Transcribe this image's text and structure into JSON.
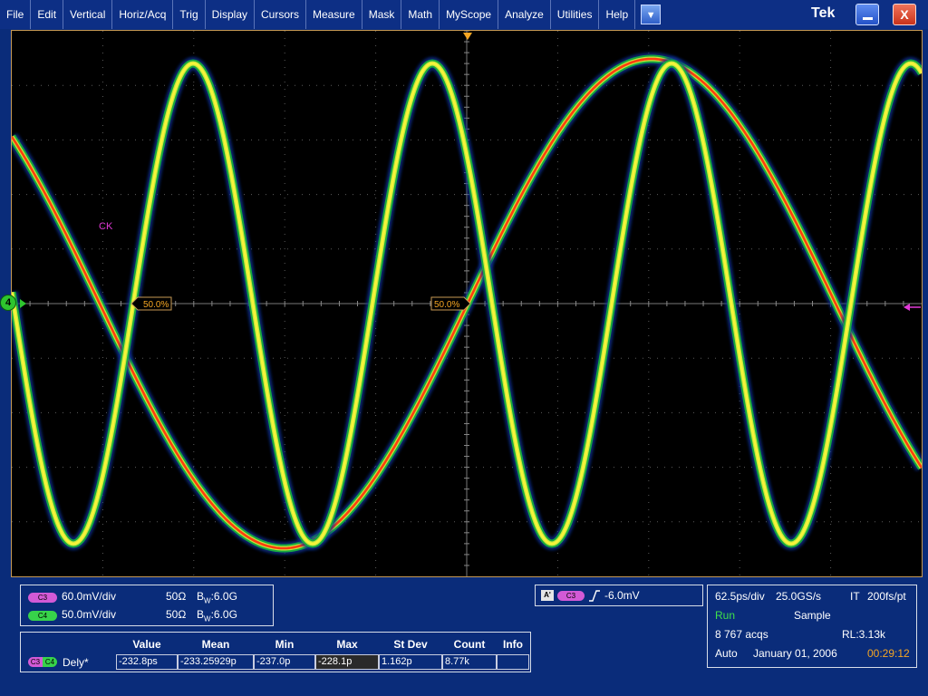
{
  "menu": [
    "File",
    "Edit",
    "Vertical",
    "Horiz/Acq",
    "Trig",
    "Display",
    "Cursors",
    "Measure",
    "Mask",
    "Math",
    "MyScope",
    "Analyze",
    "Utilities",
    "Help"
  ],
  "window": {
    "logo": "Tek",
    "minimize_label": "_",
    "close_label": "X"
  },
  "screen": {
    "channel_label": "CK",
    "ref_marker": "4",
    "level_labels": [
      "50.0%",
      "50.0%"
    ],
    "colors": {
      "grid": "#5b5b5b",
      "trace_c3": "#ff3d10",
      "trace_c4": "#f7f43a",
      "glow": "#18b63a",
      "trigger": "#f5a623",
      "ch_marker": "#2ec52e",
      "magenta": "#e23bd8"
    }
  },
  "channels": [
    {
      "id": "C3",
      "scale": "60.0mV/div",
      "impedance": "50Ω",
      "bw_prefix": "B",
      "bw_sub": "W",
      "bw": ":6.0G",
      "color": "#d35ad6"
    },
    {
      "id": "C4",
      "scale": "50.0mV/div",
      "impedance": "50Ω",
      "bw_prefix": "B",
      "bw_sub": "W",
      "bw": ":6.0G",
      "color": "#37d34a"
    }
  ],
  "trigger": {
    "mode": "A'",
    "source": "C3",
    "slope_icon": "rising-edge-icon",
    "level": "-6.0mV"
  },
  "measurement": {
    "source_left": "C3",
    "source_right": "C4",
    "name": "Dely*",
    "headers": [
      "Value",
      "Mean",
      "Min",
      "Max",
      "St Dev",
      "Count",
      "Info"
    ],
    "values": [
      "-232.8ps",
      "-233.25929p",
      "-237.0p",
      "-228.1p",
      "1.162p",
      "8.77k",
      ""
    ]
  },
  "acquisition": {
    "horizontal": "62.5ps/div",
    "sample_rate": "25.0GS/s",
    "mode": "IT",
    "resolution": "200fs/pt",
    "state": "Run",
    "acq_mode": "Sample",
    "acqs": "8 767 acqs",
    "record_length": "RL:3.13k",
    "trigger_mode": "Auto",
    "date": "January 01, 2006",
    "time": "00:29:12"
  }
}
